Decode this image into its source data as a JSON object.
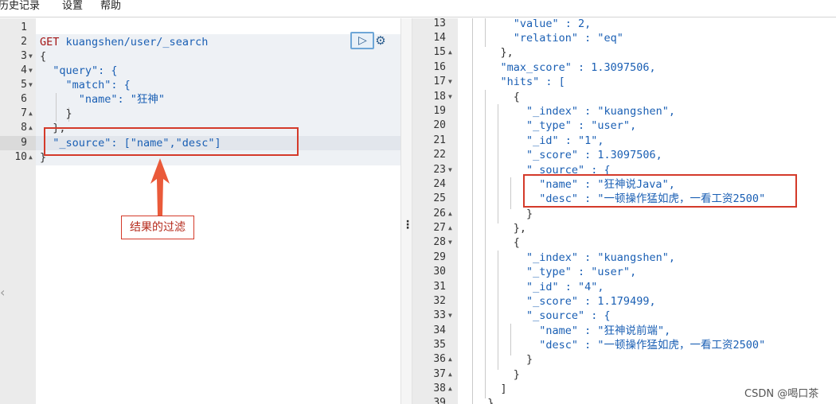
{
  "menu": {
    "history": "历史记录",
    "settings": "设置",
    "help": "帮助"
  },
  "request": {
    "lines": [
      {
        "num": "1",
        "text": ""
      },
      {
        "num": "2",
        "method": "GET",
        "path": " kuangshen/user/_search"
      },
      {
        "num": "3",
        "text": "{"
      },
      {
        "num": "4",
        "text": "  \"query\": {"
      },
      {
        "num": "5",
        "text": "    \"match\": {"
      },
      {
        "num": "6",
        "text": "      \"name\": \"狂神\""
      },
      {
        "num": "7",
        "text": "    }"
      },
      {
        "num": "8",
        "text": "  },"
      },
      {
        "num": "9",
        "text": "  \"_source\": [\"name\",\"desc\"]"
      },
      {
        "num": "10",
        "text": "}"
      }
    ]
  },
  "annotation": {
    "label": "结果的过滤",
    "color": "#d43a2a"
  },
  "response": {
    "lines": [
      {
        "num": "13",
        "text": "      \"value\" : 2,"
      },
      {
        "num": "14",
        "text": "      \"relation\" : \"eq\""
      },
      {
        "num": "15",
        "text": "    },"
      },
      {
        "num": "16",
        "text": "    \"max_score\" : 1.3097506,"
      },
      {
        "num": "17",
        "text": "    \"hits\" : ["
      },
      {
        "num": "18",
        "text": "      {"
      },
      {
        "num": "19",
        "text": "        \"_index\" : \"kuangshen\","
      },
      {
        "num": "20",
        "text": "        \"_type\" : \"user\","
      },
      {
        "num": "21",
        "text": "        \"_id\" : \"1\","
      },
      {
        "num": "22",
        "text": "        \"_score\" : 1.3097506,"
      },
      {
        "num": "23",
        "text": "        \"_source\" : {"
      },
      {
        "num": "24",
        "text": "          \"name\" : \"狂神说Java\","
      },
      {
        "num": "25",
        "text": "          \"desc\" : \"一顿操作猛如虎，一看工资2500\""
      },
      {
        "num": "26",
        "text": "        }"
      },
      {
        "num": "27",
        "text": "      },"
      },
      {
        "num": "28",
        "text": "      {"
      },
      {
        "num": "29",
        "text": "        \"_index\" : \"kuangshen\","
      },
      {
        "num": "30",
        "text": "        \"_type\" : \"user\","
      },
      {
        "num": "31",
        "text": "        \"_id\" : \"4\","
      },
      {
        "num": "32",
        "text": "        \"_score\" : 1.179499,"
      },
      {
        "num": "33",
        "text": "        \"_source\" : {"
      },
      {
        "num": "34",
        "text": "          \"name\" : \"狂神说前端\","
      },
      {
        "num": "35",
        "text": "          \"desc\" : \"一顿操作猛如虎，一看工资2500\""
      },
      {
        "num": "36",
        "text": "        }"
      },
      {
        "num": "37",
        "text": "      }"
      },
      {
        "num": "38",
        "text": "    ]"
      },
      {
        "num": "39",
        "text": "  }"
      }
    ]
  },
  "icons": {
    "run": "play-icon",
    "settings": "wrench-icon",
    "collapse": "chevron-left-icon",
    "resize": "vertical-dots-icon"
  },
  "watermark": "CSDN @喝口茶"
}
